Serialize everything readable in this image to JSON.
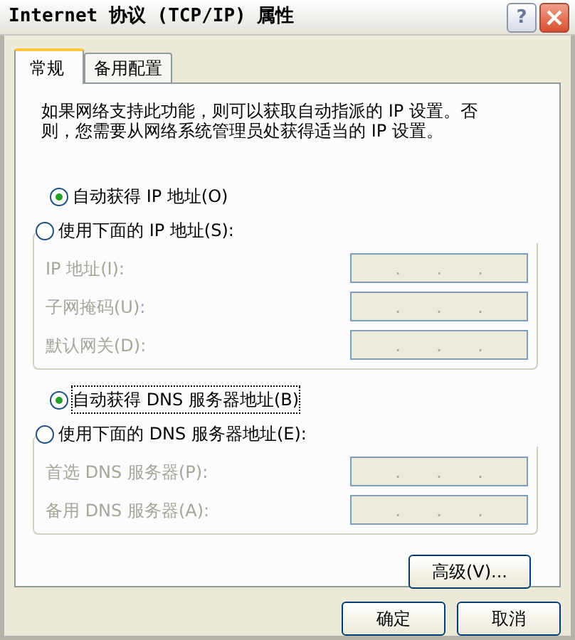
{
  "window": {
    "title": "Internet 协议 (TCP/IP) 属性",
    "help": "?"
  },
  "tabs": [
    {
      "label": "常规",
      "selected": true
    },
    {
      "label": "备用配置",
      "selected": false
    }
  ],
  "description": "如果网络支持此功能，则可以获取自动指派的 IP 设置。否则，您需要从网络系统管理员处获得适当的 IP 设置。",
  "ip_options": [
    {
      "label": "自动获得 IP 地址(O)",
      "selected": true,
      "focused": false
    },
    {
      "label": "使用下面的 IP 地址(S):",
      "selected": false,
      "focused": false
    }
  ],
  "ip_fields": [
    {
      "label": "IP 地址(I):",
      "disabled": true,
      "separators": [
        ".",
        ".",
        "."
      ]
    },
    {
      "label": "子网掩码(U):",
      "disabled": true,
      "separators": [
        ".",
        ".",
        "."
      ]
    },
    {
      "label": "默认网关(D):",
      "disabled": true,
      "separators": [
        ".",
        ".",
        "."
      ]
    }
  ],
  "dns_options": [
    {
      "label": "自动获得 DNS 服务器地址(B)",
      "selected": true,
      "focused": true
    },
    {
      "label": "使用下面的 DNS 服务器地址(E):",
      "selected": false,
      "focused": false
    }
  ],
  "dns_fields": [
    {
      "label": "首选 DNS 服务器(P):",
      "disabled": true,
      "separators": [
        ".",
        ".",
        "."
      ]
    },
    {
      "label": "备用 DNS 服务器(A):",
      "disabled": true,
      "separators": [
        ".",
        ".",
        "."
      ]
    }
  ],
  "advanced_button": "高级(V)...",
  "footer_buttons": [
    "确定",
    "取消"
  ]
}
